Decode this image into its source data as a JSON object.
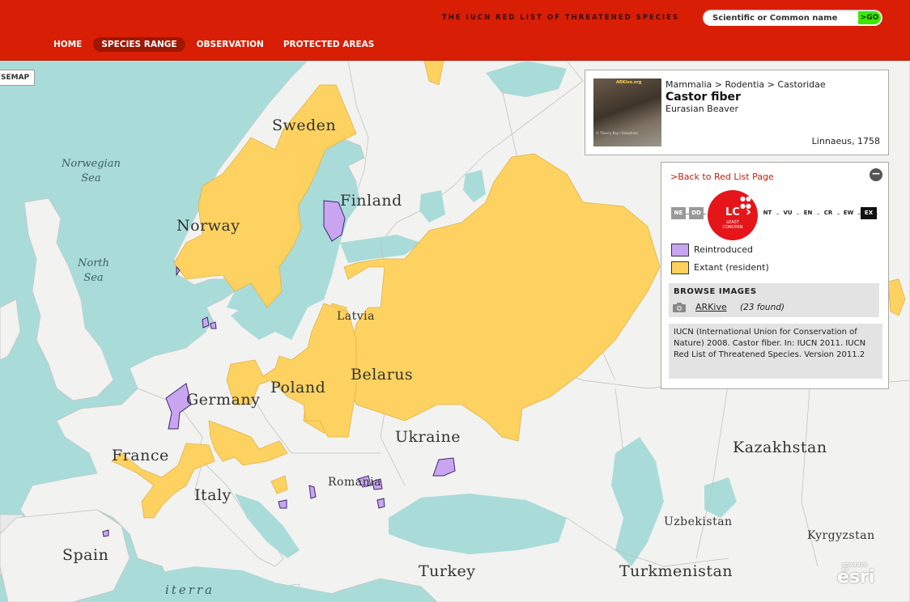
{
  "header": {
    "tagline": "THE IUCN RED LIST OF THREATENED SPECIES",
    "search_placeholder": "Scientific or Common name",
    "go_label": ">GO",
    "nav": [
      {
        "label": "HOME",
        "active": false
      },
      {
        "label": "SPECIES RANGE",
        "active": true
      },
      {
        "label": "OBSERVATION",
        "active": false
      },
      {
        "label": "PROTECTED AREAS",
        "active": false
      }
    ]
  },
  "map": {
    "basemap_button": "SEMAP",
    "countries": [
      "Sweden",
      "Finland",
      "Norway",
      "Latvia",
      "Belarus",
      "Germany",
      "Poland",
      "Ukraine",
      "Kazakhstan",
      "France",
      "Italy",
      "Romania",
      "Spain",
      "Turkey",
      "Uzbekistan",
      "Kyrgyzstan",
      "Turkmenistan"
    ],
    "seas": [
      "Norwegian Sea",
      "North Sea",
      "Mediterranean (partial)"
    ],
    "sea_lines": {
      "norwegian": [
        "Norwegian",
        "Sea"
      ],
      "north": [
        "North",
        "Sea"
      ],
      "med": "iterra"
    },
    "attribution": "esri",
    "attribution_small": "POWERED BY",
    "colors": {
      "extant": "#ffd15c",
      "reintroduced": "#c9a4f0",
      "water": "#a9dcd9",
      "land": "#f2f2f0"
    }
  },
  "species": {
    "taxonomy": "Mammalia > Rodentia > Castoridae",
    "scientific_name": "Castor fiber",
    "common_name": "Eurasian Beaver",
    "authority": "Linnaeus, 1758",
    "photo_brand": "ARKive.org",
    "photo_credit": "© Thierry Roy / Biosphoto"
  },
  "panel": {
    "back_link": ">Back to Red List Page",
    "collapse_symbol": "−",
    "status": {
      "abbr": "LC",
      "full": [
        "LEAST",
        "CONCERN"
      ],
      "scale_before": [
        "NE",
        "DD"
      ],
      "scale_after": [
        "NT",
        "VU",
        "EN",
        "CR",
        "EW",
        "EX"
      ]
    },
    "legend": [
      {
        "label": "Reintroduced",
        "color": "#c9a4f0"
      },
      {
        "label": "Extant (resident)",
        "color": "#ffd15c"
      }
    ],
    "browse": {
      "heading": "BROWSE IMAGES",
      "link": "ARKive",
      "count": "(23 found)"
    },
    "citation": "IUCN (International Union for Conservation of Nature) 2008. Castor fiber. In: IUCN 2011. IUCN Red List of Threatened Species. Version 2011.2"
  }
}
